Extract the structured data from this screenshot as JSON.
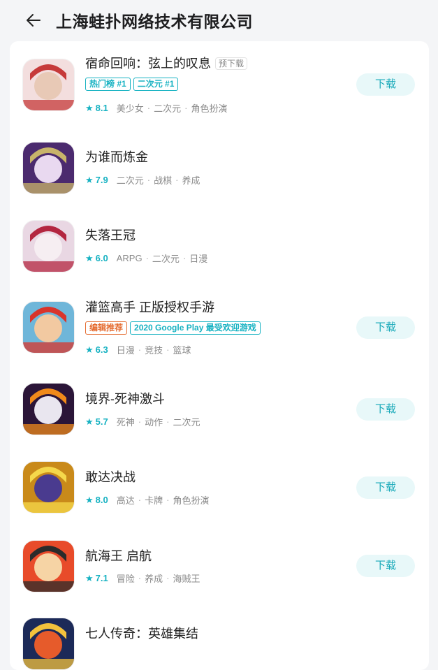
{
  "header": {
    "title": "上海蛙扑网络技术有限公司",
    "back_icon": "arrow-left-icon"
  },
  "colors": {
    "accent": "#17b2c2",
    "editor_tag": "#e56b2f",
    "button_bg": "#e8f8f9"
  },
  "apps": [
    {
      "name": "宿命回响：弦上的叹息",
      "badge": "预下载",
      "tags": [
        {
          "text": "热门榜 #1",
          "style": "cyan"
        },
        {
          "text": "二次元 #1",
          "style": "cyan"
        }
      ],
      "rating": "8.1",
      "categories": [
        "美少女",
        "二次元",
        "角色扮演"
      ],
      "button": "下载"
    },
    {
      "name": "为谁而炼金",
      "badge": "",
      "tags": [],
      "rating": "7.9",
      "categories": [
        "二次元",
        "战棋",
        "养成"
      ],
      "button": ""
    },
    {
      "name": "失落王冠",
      "badge": "",
      "tags": [],
      "rating": "6.0",
      "categories": [
        "ARPG",
        "二次元",
        "日漫"
      ],
      "button": ""
    },
    {
      "name": "灌篮高手 正版授权手游",
      "badge": "",
      "tags": [
        {
          "text": "编辑推荐",
          "style": "orange"
        },
        {
          "text": "2020 Google Play 最受欢迎游戏",
          "style": "cyan"
        }
      ],
      "rating": "6.3",
      "categories": [
        "日漫",
        "竞技",
        "篮球"
      ],
      "button": "下载"
    },
    {
      "name": "境界-死神激斗",
      "badge": "",
      "tags": [],
      "rating": "5.7",
      "categories": [
        "死神",
        "动作",
        "二次元"
      ],
      "button": "下载"
    },
    {
      "name": "敢达决战",
      "badge": "",
      "tags": [],
      "rating": "8.0",
      "categories": [
        "高达",
        "卡牌",
        "角色扮演"
      ],
      "button": "下载"
    },
    {
      "name": "航海王 启航",
      "badge": "",
      "tags": [],
      "rating": "7.1",
      "categories": [
        "冒险",
        "养成",
        "海贼王"
      ],
      "button": "下载"
    },
    {
      "name": "七人传奇：英雄集结",
      "badge": "",
      "tags": [],
      "rating": "",
      "categories": [],
      "button": ""
    }
  ]
}
